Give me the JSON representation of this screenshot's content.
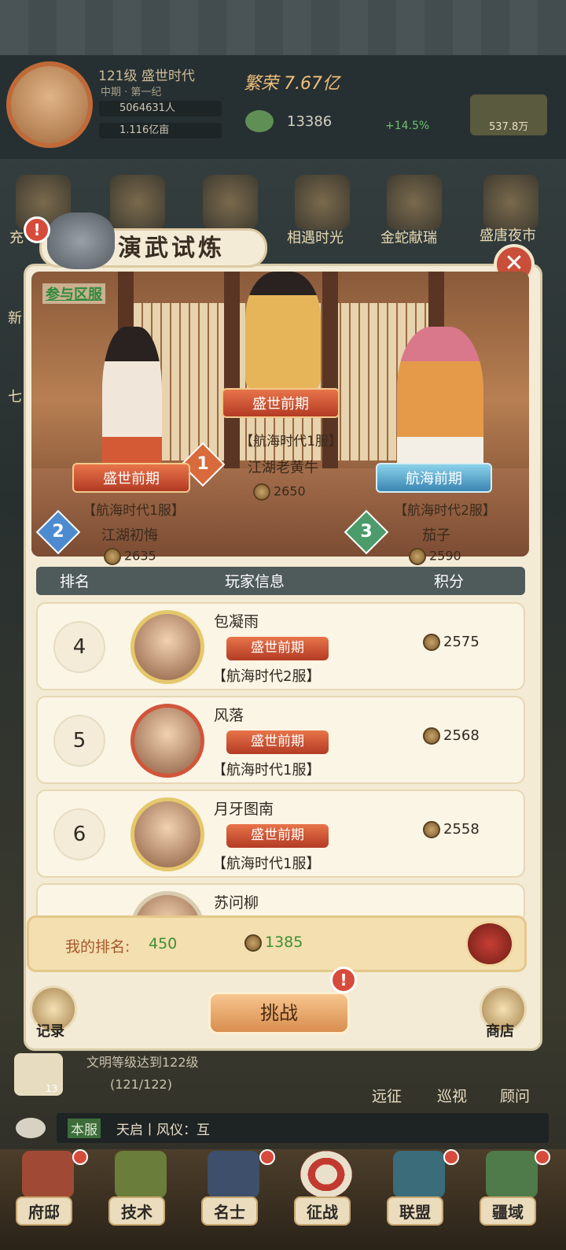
{
  "hud": {
    "level": "121级",
    "era": "盛世时代",
    "subera": "中期 · 第一纪",
    "population": "5064631人",
    "land": "1.116亿亩",
    "prosperity": "繁荣 7.67亿",
    "coins": "13386",
    "growth": "+14.5%",
    "wood": "537.8万"
  },
  "bg_icons": [
    "充",
    "相遇时光",
    "金蛇献瑞",
    "盛唐夜市",
    "新",
    "七"
  ],
  "panel": {
    "title": "演武试炼",
    "participate_link": "参与区服",
    "close": "✕"
  },
  "podium": [
    {
      "rank": "1",
      "stage": "盛世前期",
      "server": "【航海时代1服】",
      "name": "江湖老黄牛",
      "score": "2650"
    },
    {
      "rank": "2",
      "stage": "盛世前期",
      "server": "【航海时代1服】",
      "name": "江湖初悔",
      "score": "2635"
    },
    {
      "rank": "3",
      "stage": "航海前期",
      "server": "【航海时代2服】",
      "name": "茄子",
      "score": "2590"
    }
  ],
  "table": {
    "col_rank": "排名",
    "col_info": "玩家信息",
    "col_score": "积分",
    "rows": [
      {
        "rank": "4",
        "name": "包凝雨",
        "stage": "盛世前期",
        "server": "【航海时代2服】",
        "score": "2575"
      },
      {
        "rank": "5",
        "name": "风落",
        "stage": "盛世前期",
        "server": "【航海时代1服】",
        "score": "2568"
      },
      {
        "rank": "6",
        "name": "月牙图南",
        "stage": "盛世前期",
        "server": "【航海时代1服】",
        "score": "2558"
      },
      {
        "rank": "",
        "name": "苏问柳",
        "stage": "",
        "server": "",
        "score": ""
      }
    ]
  },
  "my_rank": {
    "label": "我的排名:",
    "value": "450",
    "score": "1385"
  },
  "buttons": {
    "challenge": "挑战",
    "record": "记录",
    "shop": "商店"
  },
  "behind": {
    "task": "文明等级达到122级",
    "task_progress": "(121/122)",
    "task_count": "13",
    "expedition": "远征",
    "patrol": "巡视",
    "advisor": "顾问",
    "chat_tag": "本服",
    "chat_text": "天启丨风仪：互"
  },
  "nav": [
    "府邸",
    "技术",
    "名士",
    "征战",
    "联盟",
    "疆域"
  ]
}
